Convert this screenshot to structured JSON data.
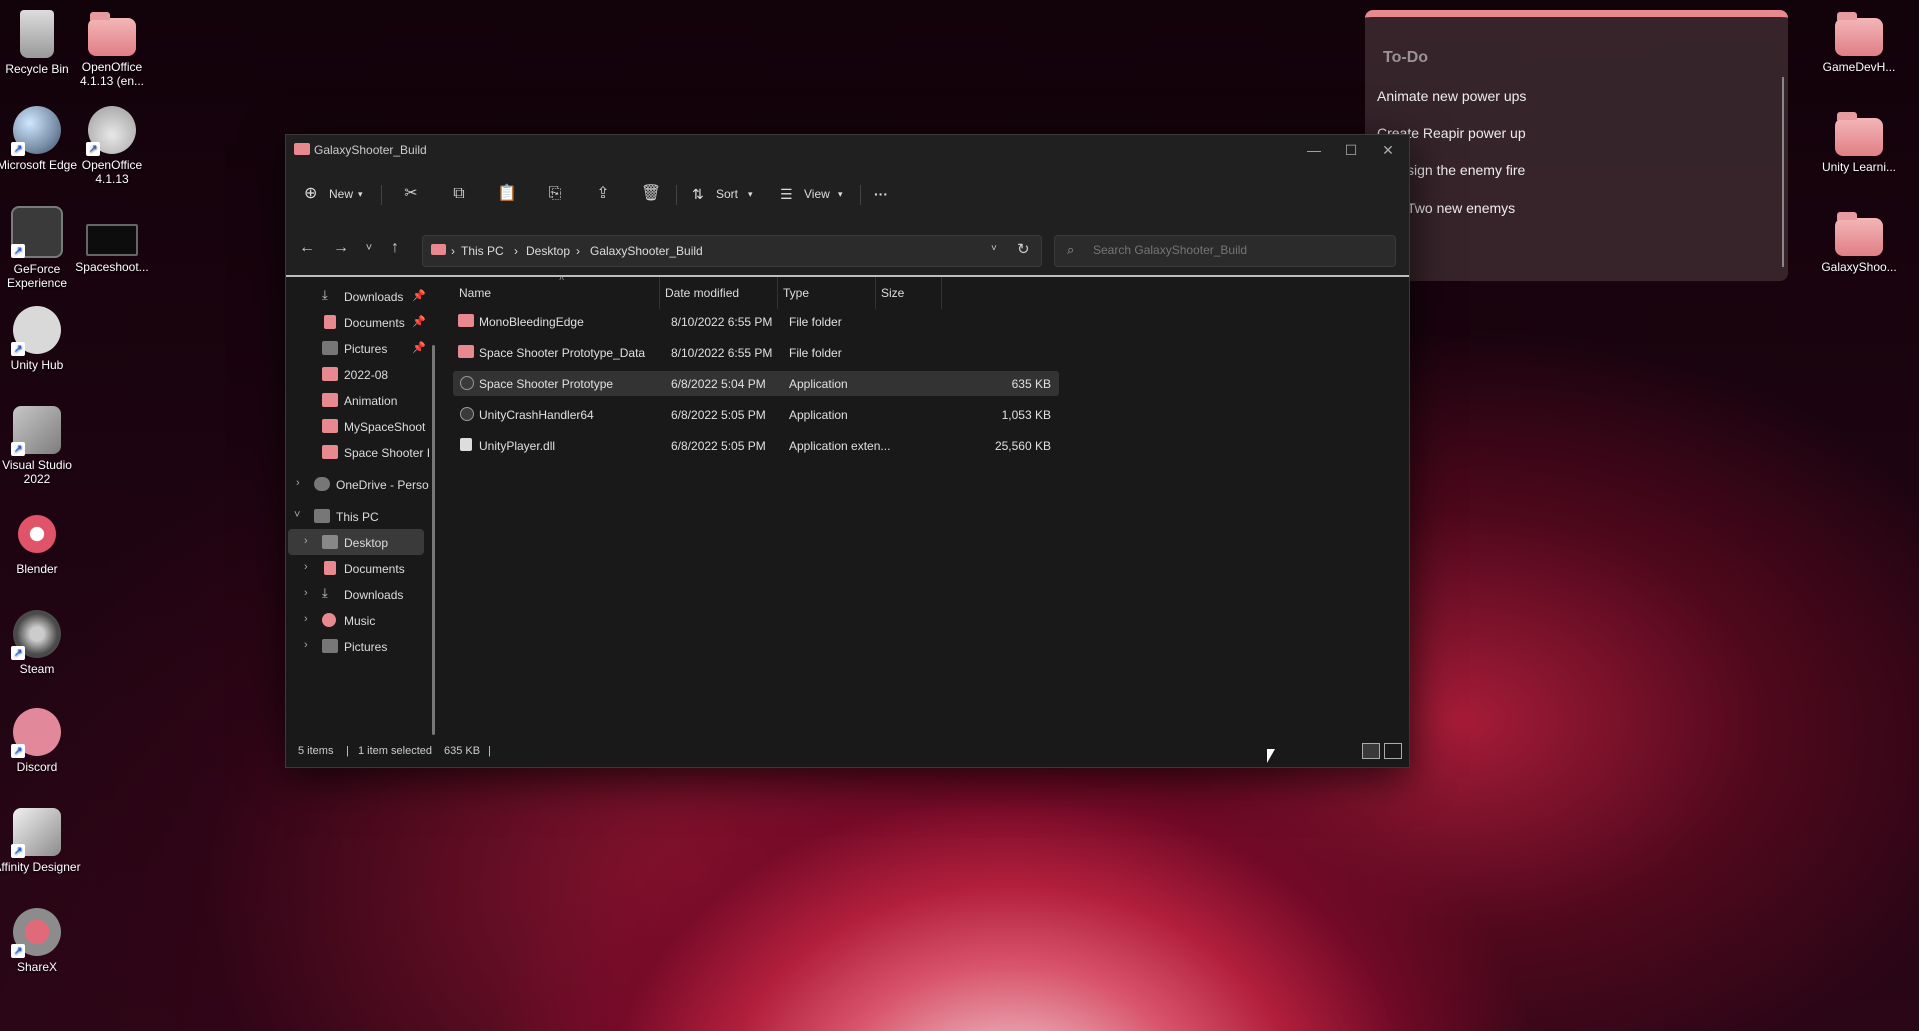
{
  "desktop": {
    "left_column_1": [
      {
        "label": "Recycle Bin",
        "icon": "recycle-bin-icon"
      },
      {
        "label": "Microsoft Edge",
        "icon": "edge-icon"
      },
      {
        "label": "GeForce Experience",
        "icon": "geforce-icon"
      },
      {
        "label": "Unity Hub",
        "icon": "unity-hub-icon"
      },
      {
        "label": "Visual Studio 2022",
        "icon": "visual-studio-icon"
      },
      {
        "label": "Blender",
        "icon": "blender-icon"
      },
      {
        "label": "Steam",
        "icon": "steam-icon"
      },
      {
        "label": "Discord",
        "icon": "discord-icon"
      },
      {
        "label": "Affinity Designer",
        "icon": "affinity-designer-icon"
      },
      {
        "label": "ShareX",
        "icon": "sharex-icon"
      }
    ],
    "left_column_2": [
      {
        "label": "OpenOffice 4.1.13 (en...",
        "icon": "folder-icon"
      },
      {
        "label": "OpenOffice 4.1.13",
        "icon": "openoffice-icon"
      },
      {
        "label": "Spaceshoot...",
        "icon": "video-thumbnail-icon"
      }
    ],
    "right_column": [
      {
        "label": "GameDevH...",
        "icon": "folder-icon"
      },
      {
        "label": "Unity Learni...",
        "icon": "folder-icon"
      },
      {
        "label": "GalaxyShoo...",
        "icon": "folder-icon"
      }
    ]
  },
  "todo": {
    "title": "To-Do",
    "tasks": [
      "Animate new power ups",
      "Create Reapir power up",
      "sign the enemy fire",
      "Two new enemys"
    ]
  },
  "window": {
    "title": "GalaxyShooter_Build",
    "toolbar": {
      "new_label": "New",
      "sort_label": "Sort",
      "view_label": "View",
      "more_label": "···"
    },
    "breadcrumb": [
      "This PC",
      "Desktop",
      "GalaxyShooter_Build"
    ],
    "search_placeholder": "Search GalaxyShooter_Build",
    "nav_items": {
      "downloads": "Downloads",
      "documents": "Documents",
      "pictures": "Pictures",
      "f2022": "2022-08",
      "animation": "Animation",
      "myspace": "MySpaceShoot",
      "spaceshooter": "Space Shooter I",
      "onedrive": "OneDrive - Perso",
      "thispc": "This PC",
      "desktop": "Desktop",
      "documents2": "Documents",
      "downloads2": "Downloads",
      "music": "Music",
      "pictures2": "Pictures"
    },
    "columns": {
      "name": "Name",
      "date": "Date modified",
      "type": "Type",
      "size": "Size"
    },
    "files": [
      {
        "name": "MonoBleedingEdge",
        "date": "8/10/2022 6:55 PM",
        "type": "File folder",
        "size": ""
      },
      {
        "name": "Space Shooter Prototype_Data",
        "date": "8/10/2022 6:55 PM",
        "type": "File folder",
        "size": ""
      },
      {
        "name": "Space Shooter Prototype",
        "date": "6/8/2022 5:04 PM",
        "type": "Application",
        "size": "635 KB"
      },
      {
        "name": "UnityCrashHandler64",
        "date": "6/8/2022 5:05 PM",
        "type": "Application",
        "size": "1,053 KB"
      },
      {
        "name": "UnityPlayer.dll",
        "date": "6/8/2022 5:05 PM",
        "type": "Application exten...",
        "size": "25,560 KB"
      }
    ],
    "status": {
      "items": "5 items",
      "selected": "1 item selected",
      "size": "635 KB"
    }
  },
  "colors": {
    "folder": "#e8898f",
    "window_bg": "#191919",
    "chrome_bg": "#202020",
    "selection": "#333333"
  }
}
